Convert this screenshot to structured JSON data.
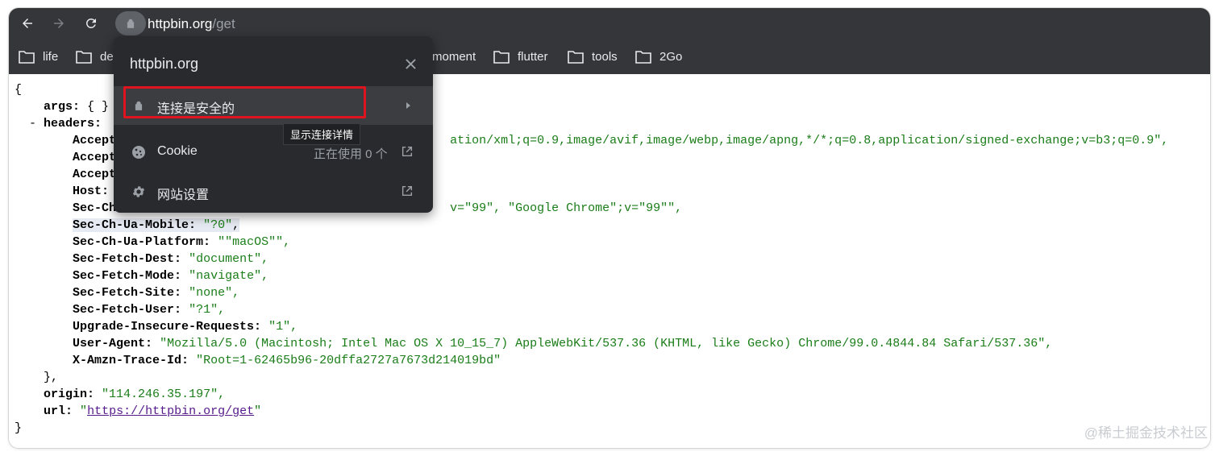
{
  "toolbar": {
    "back_icon": "arrow-left-icon",
    "forward_icon": "arrow-right-icon",
    "reload_icon": "reload-icon",
    "url_host": "httpbin.org",
    "url_path": "/get"
  },
  "bookmarks": [
    {
      "label": "life"
    },
    {
      "label": "de"
    },
    {
      "label": "moment"
    },
    {
      "label": "flutter"
    },
    {
      "label": "tools"
    },
    {
      "label": "2Go"
    }
  ],
  "popup": {
    "title": "httpbin.org",
    "secure_label": "连接是安全的",
    "tooltip": "显示连接详情",
    "cookie_label": "Cookie",
    "cookie_usage": "正在使用 0 个",
    "site_settings_label": "网站设置"
  },
  "json_view": {
    "open_brace": "{",
    "args_key": "args:",
    "args_val": "{ }",
    "headers_toggle": "-",
    "headers_key": "headers:",
    "accept_1_key": "Accept",
    "accept_1_val": "ation/xml;q=0.9,image/avif,image/webp,image/apng,*/*;q=0.8,application/signed-exchange;v=b3;q=0.9\",",
    "accept_2_key": "Accept",
    "accept_3_key": "Accept",
    "host_key": "Host:",
    "sec_ch_key": "Sec-Ch",
    "sec_ch_val": "v=\"99\", \"Google Chrome\";v=\"99\"\",",
    "mobile_key": "Sec-Ch-Ua-Mobile:",
    "mobile_val": "\"?0\"",
    "platform_key": "Sec-Ch-Ua-Platform:",
    "platform_val": "\"\"macOS\"\",",
    "dest_key": "Sec-Fetch-Dest:",
    "dest_val": "\"document\",",
    "mode_key": "Sec-Fetch-Mode:",
    "mode_val": "\"navigate\",",
    "site_key": "Sec-Fetch-Site:",
    "site_val": "\"none\",",
    "user_key": "Sec-Fetch-User:",
    "user_val": "\"?1\",",
    "upgrade_key": "Upgrade-Insecure-Requests:",
    "upgrade_val": "\"1\",",
    "ua_key": "User-Agent:",
    "ua_val": "\"Mozilla/5.0 (Macintosh; Intel Mac OS X 10_15_7) AppleWebKit/537.36 (KHTML, like Gecko) Chrome/99.0.4844.84 Safari/537.36\",",
    "trace_key": "X-Amzn-Trace-Id:",
    "trace_val": "\"Root=1-62465b96-20dffa2727a7673d214019bd\"",
    "headers_close": "},",
    "origin_key": "origin:",
    "origin_val": "\"114.246.35.197\",",
    "url_key": "url:",
    "url_quote": "\"",
    "url_link": "https://httpbin.org/get",
    "close_brace": "}"
  },
  "watermark": "@稀土掘金技术社区"
}
